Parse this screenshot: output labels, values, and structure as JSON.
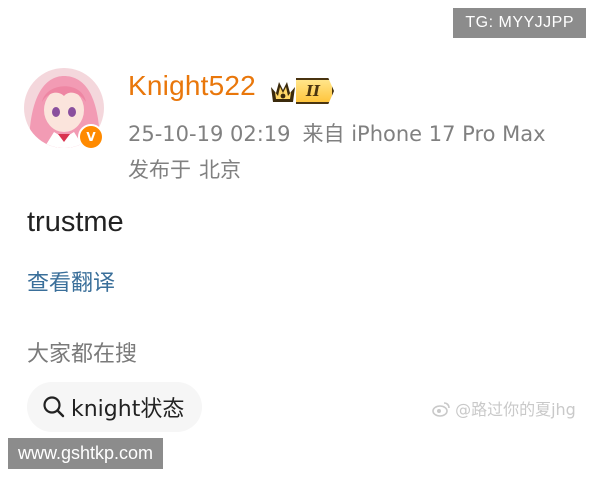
{
  "overlay": {
    "tg_label": "TG: MYYJJPP",
    "site_label": "www.gshtkp.com"
  },
  "post": {
    "author": {
      "name": "Knight522",
      "vip_level": "II",
      "verified_badge_icon": "verified-v-icon"
    },
    "meta": {
      "timestamp": "25-10-19 02:19",
      "source": "来自 iPhone 17 Pro Max"
    },
    "location": {
      "prefix": "发布于",
      "city": "北京"
    },
    "text": "trustme",
    "translate_label": "查看翻译"
  },
  "search": {
    "heading": "大家都在搜",
    "chip_label": "knight状态"
  },
  "watermark": {
    "text": "@路过你的夏jhg"
  },
  "colors": {
    "username": "#e9770b",
    "link": "#3a6f9a",
    "meta_text": "#808080",
    "verified_badge": "#ff8a00",
    "vip_gold": "#ffc53d"
  }
}
